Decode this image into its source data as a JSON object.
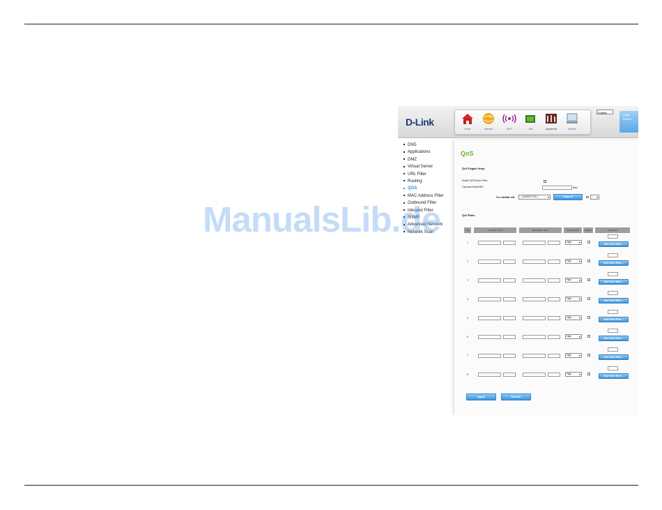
{
  "header": {
    "logo": "D-Link",
    "nav": [
      {
        "label": "Home",
        "icon": "home-icon"
      },
      {
        "label": "Internet",
        "icon": "globe-icon"
      },
      {
        "label": "Wi-Fi",
        "icon": "wifi-icon"
      },
      {
        "label": "LAN",
        "icon": "lan-icon"
      },
      {
        "label": "Advanced",
        "icon": "advanced-icon"
      },
      {
        "label": "System",
        "icon": "computer-icon"
      }
    ],
    "language": "English",
    "side_links": [
      "Logout",
      "Refresh"
    ]
  },
  "sidebar": {
    "items": [
      "DNS",
      "Applications",
      "DMZ",
      "Virtual Server",
      "URL Filter",
      "Routing",
      "QOS",
      "MAC Address Filter",
      "Outbound Filter",
      "Inbound Filter",
      "SNMP",
      "Advanced Network",
      "Network Scan"
    ],
    "active": "QOS"
  },
  "page": {
    "title": "QoS",
    "engine_section": "QoS Engine Setup",
    "enable_label": "Enable QoS Packet Filter:",
    "upstream_label": "Upstream bandwidth :",
    "upstream_unit": "kbps",
    "schedule_label": "Use schedule rule",
    "schedule_value": "---ALWAYS ON---",
    "copy_button": "Copy to",
    "id_label": "ID",
    "id_value": "--",
    "rules_section": "QoS Rules",
    "columns": {
      "id": "ID",
      "local": "Local IP : Ports",
      "remote": "Remote IP : Ports",
      "priority": "QoS Priority",
      "enable": "Enable",
      "use_rule": "Use Rules"
    },
    "rows": [
      {
        "id": "1",
        "priority": "High",
        "add_label": "Add New Rule..."
      },
      {
        "id": "2",
        "priority": "High",
        "add_label": "Add New Rule..."
      },
      {
        "id": "3",
        "priority": "High",
        "add_label": "Add New Rule..."
      },
      {
        "id": "4",
        "priority": "High",
        "add_label": "Add New Rule..."
      },
      {
        "id": "5",
        "priority": "High",
        "add_label": "Add New Rule..."
      },
      {
        "id": "6",
        "priority": "High",
        "add_label": "Add New Rule..."
      },
      {
        "id": "7",
        "priority": "High",
        "add_label": "Add New Rule..."
      },
      {
        "id": "8",
        "priority": "High",
        "add_label": "Add New Rule..."
      }
    ],
    "apply_button": "Apply",
    "refresh_button": "Refresh"
  },
  "watermark": "ManualsLib.de",
  "colors": {
    "accent": "#2e8fd8",
    "title_green": "#6cb42c",
    "button_blue": "#3e93dc"
  }
}
